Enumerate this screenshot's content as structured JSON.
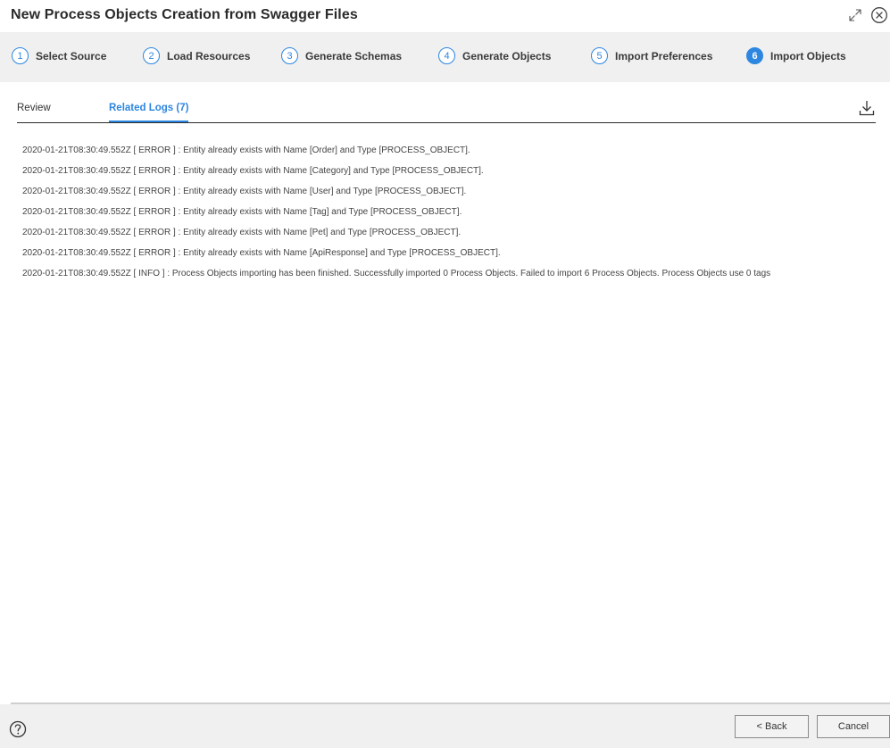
{
  "dialog": {
    "title": "New Process Objects Creation from Swagger Files"
  },
  "steps": [
    {
      "num": "1",
      "label": "Select Source"
    },
    {
      "num": "2",
      "label": "Load Resources"
    },
    {
      "num": "3",
      "label": "Generate Schemas"
    },
    {
      "num": "4",
      "label": "Generate Objects"
    },
    {
      "num": "5",
      "label": "Import Preferences"
    },
    {
      "num": "6",
      "label": "Import Objects"
    }
  ],
  "active_step": "6",
  "tabs": {
    "review": "Review",
    "related_logs": "Related Logs (7)"
  },
  "logs": [
    "2020-01-21T08:30:49.552Z [ ERROR ] : Entity already exists with Name [Order] and Type [PROCESS_OBJECT].",
    "2020-01-21T08:30:49.552Z [ ERROR ] : Entity already exists with Name [Category] and Type [PROCESS_OBJECT].",
    "2020-01-21T08:30:49.552Z [ ERROR ] : Entity already exists with Name [User] and Type [PROCESS_OBJECT].",
    "2020-01-21T08:30:49.552Z [ ERROR ] : Entity already exists with Name [Tag] and Type [PROCESS_OBJECT].",
    "2020-01-21T08:30:49.552Z [ ERROR ] : Entity already exists with Name [Pet] and Type [PROCESS_OBJECT].",
    "2020-01-21T08:30:49.552Z [ ERROR ] : Entity already exists with Name [ApiResponse] and Type [PROCESS_OBJECT].",
    "2020-01-21T08:30:49.552Z [ INFO ] : Process Objects importing has been finished. Successfully imported 0 Process Objects. Failed to import 6 Process Objects. Process Objects use 0 tags"
  ],
  "footer": {
    "back_label": "< Back",
    "cancel_label": "Cancel"
  },
  "icons": {
    "expand": "expand-icon",
    "close": "close-icon",
    "download": "download-icon",
    "help": "help-icon"
  },
  "colors": {
    "accent": "#2d86e0",
    "steps_bg": "#f0f0f0"
  }
}
